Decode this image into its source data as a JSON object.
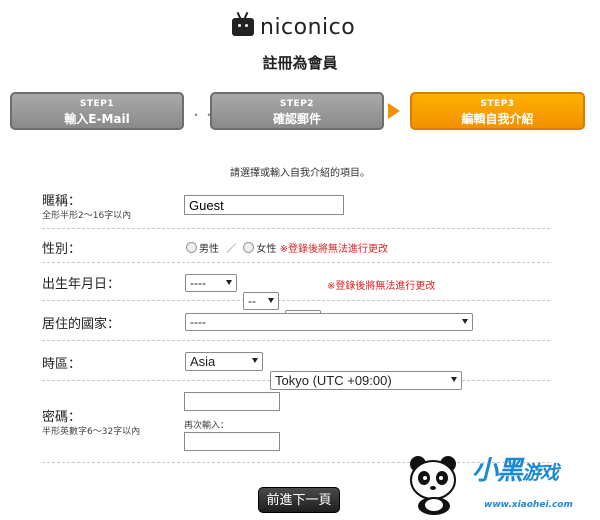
{
  "logo": {
    "wordmark": "niconico"
  },
  "page_title": "註冊為會員",
  "steps": [
    {
      "num": "STEP1",
      "label": "輸入E-Mail",
      "state": "inactive"
    },
    {
      "num": "STEP2",
      "label": "確認郵件",
      "state": "inactive"
    },
    {
      "num": "STEP3",
      "label": "編輯自我介紹",
      "state": "active"
    }
  ],
  "steps_separator": "・・・",
  "instruction": "請選擇或輸入自我介紹的項目。",
  "nickname": {
    "label": "暱稱：",
    "note": "全形半形2～16字以內",
    "value": "Guest"
  },
  "gender": {
    "label": "性別：",
    "male": "男性",
    "divider": "／",
    "female": "女性",
    "warning": "※登錄後將無法進行更改"
  },
  "birthday": {
    "label": "出生年月日：",
    "year": "----",
    "month": "--",
    "day": "--",
    "warning": "※登錄後將無法進行更改"
  },
  "country": {
    "label": "居住的國家：",
    "value": "----"
  },
  "timezone": {
    "label": "時區：",
    "region": "Asia",
    "zone": "Tokyo (UTC +09:00)"
  },
  "password": {
    "label": "密碼：",
    "note": "半形英數字6～32字以內",
    "value": "",
    "confirm_label": "再次輸入：",
    "confirm_value": ""
  },
  "next_button": "前進下一頁",
  "watermark": {
    "title_a": "小黑",
    "title_b": "游戏",
    "url": "www.xiaohei.com"
  },
  "colors": {
    "accent_orange": "#f39000",
    "step_gray": "#8a8a8a",
    "warning_red": "#e02020",
    "watermark_blue": "#1a8ad4"
  }
}
